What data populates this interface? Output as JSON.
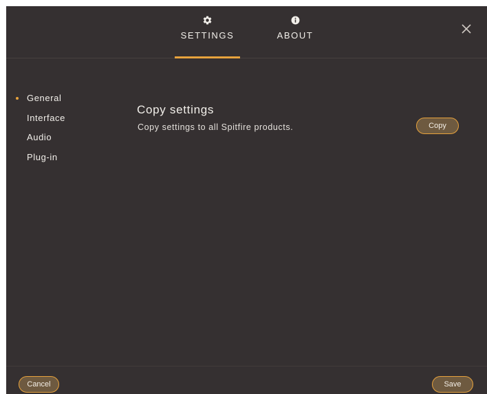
{
  "header": {
    "tabs": [
      {
        "label": "SETTINGS",
        "icon": "gear-icon",
        "active": true
      },
      {
        "label": "ABOUT",
        "icon": "info-icon",
        "active": false
      }
    ],
    "close_icon": "close-icon"
  },
  "sidebar": {
    "items": [
      {
        "label": "General",
        "active": true
      },
      {
        "label": "Interface",
        "active": false
      },
      {
        "label": "Audio",
        "active": false
      },
      {
        "label": "Plug-in",
        "active": false
      }
    ]
  },
  "main": {
    "title": "Copy settings",
    "description": "Copy settings to all Spitfire products.",
    "copy_label": "Copy"
  },
  "footer": {
    "cancel_label": "Cancel",
    "save_label": "Save"
  },
  "colors": {
    "background": "#353031",
    "accent": "#e8a33d",
    "button_fill": "#6e5a40",
    "text": "#f2efea"
  }
}
